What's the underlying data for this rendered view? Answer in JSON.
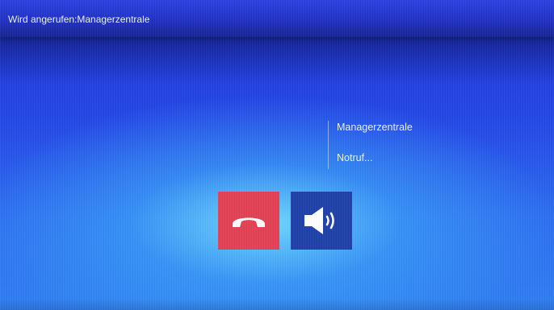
{
  "header": {
    "title": "Wird angerufen:Managerzentrale"
  },
  "call": {
    "caller_name": "Managerzentrale",
    "status": "Notruf..."
  },
  "buttons": {
    "hangup_icon": "phone-hangup-icon",
    "speaker_icon": "speaker-volume-icon"
  },
  "colors": {
    "hangup_button": "#e33f52",
    "speaker_button": "#1d3fa8",
    "titlebar": "#1e2fc4",
    "background": "#2a6cf0"
  }
}
